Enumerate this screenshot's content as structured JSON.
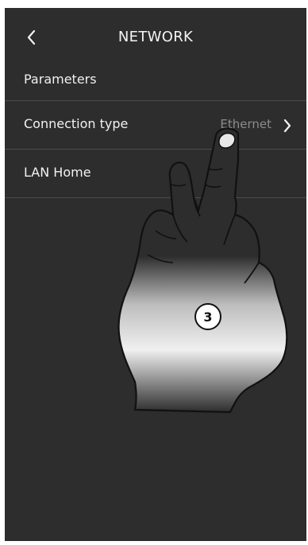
{
  "header": {
    "title": "NETWORK",
    "back_icon": "chevron-left-icon"
  },
  "section": {
    "label": "Parameters"
  },
  "rows": [
    {
      "label": "Connection type",
      "value": "Ethernet",
      "icon": "chevron-right-icon"
    },
    {
      "label": "LAN Home"
    }
  ],
  "overlay": {
    "step_number": "3",
    "icon": "pointing-hand-icon"
  },
  "colors": {
    "background": "#2d2d2d",
    "text": "#f2f2f2",
    "value_text": "#8c8c8c",
    "divider": "#4b4b4b"
  }
}
